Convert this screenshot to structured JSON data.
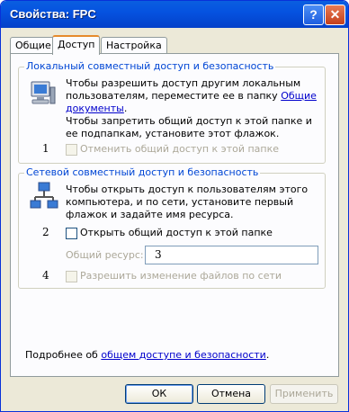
{
  "window": {
    "title": "Свойства: FPC"
  },
  "tabs": [
    {
      "label": "Общие"
    },
    {
      "label": "Доступ"
    },
    {
      "label": "Настройка"
    }
  ],
  "local_group": {
    "legend": "Локальный совместный доступ и безопасность",
    "text1": "Чтобы разрешить доступ другим локальным пользователям, переместите ее в папку",
    "link": "Общие документы",
    "text1_end": ".",
    "text2": "Чтобы запретить общий доступ к этой папке и ее подпапкам, установите этот флажок.",
    "marker": "1",
    "checkbox_label": "Отменить общий доступ к этой папке"
  },
  "network_group": {
    "legend": "Сетевой совместный доступ и безопасность",
    "text": "Чтобы открыть доступ к пользователям этого компьютера, и по сети, установите первый флажок и задайте имя ресурса.",
    "marker2": "2",
    "share_checkbox_label": "Открыть общий доступ к этой папке",
    "share_name_label": "Общий ресурс:",
    "share_name_value": "3",
    "marker4": "4",
    "allow_checkbox_label": "Разрешить изменение файлов по сети"
  },
  "footer": {
    "text": "Подробнее об",
    "link": "общем доступе и безопасности",
    "end": "."
  },
  "buttons": {
    "ok": "ОК",
    "cancel": "Отмена",
    "apply": "Применить"
  }
}
